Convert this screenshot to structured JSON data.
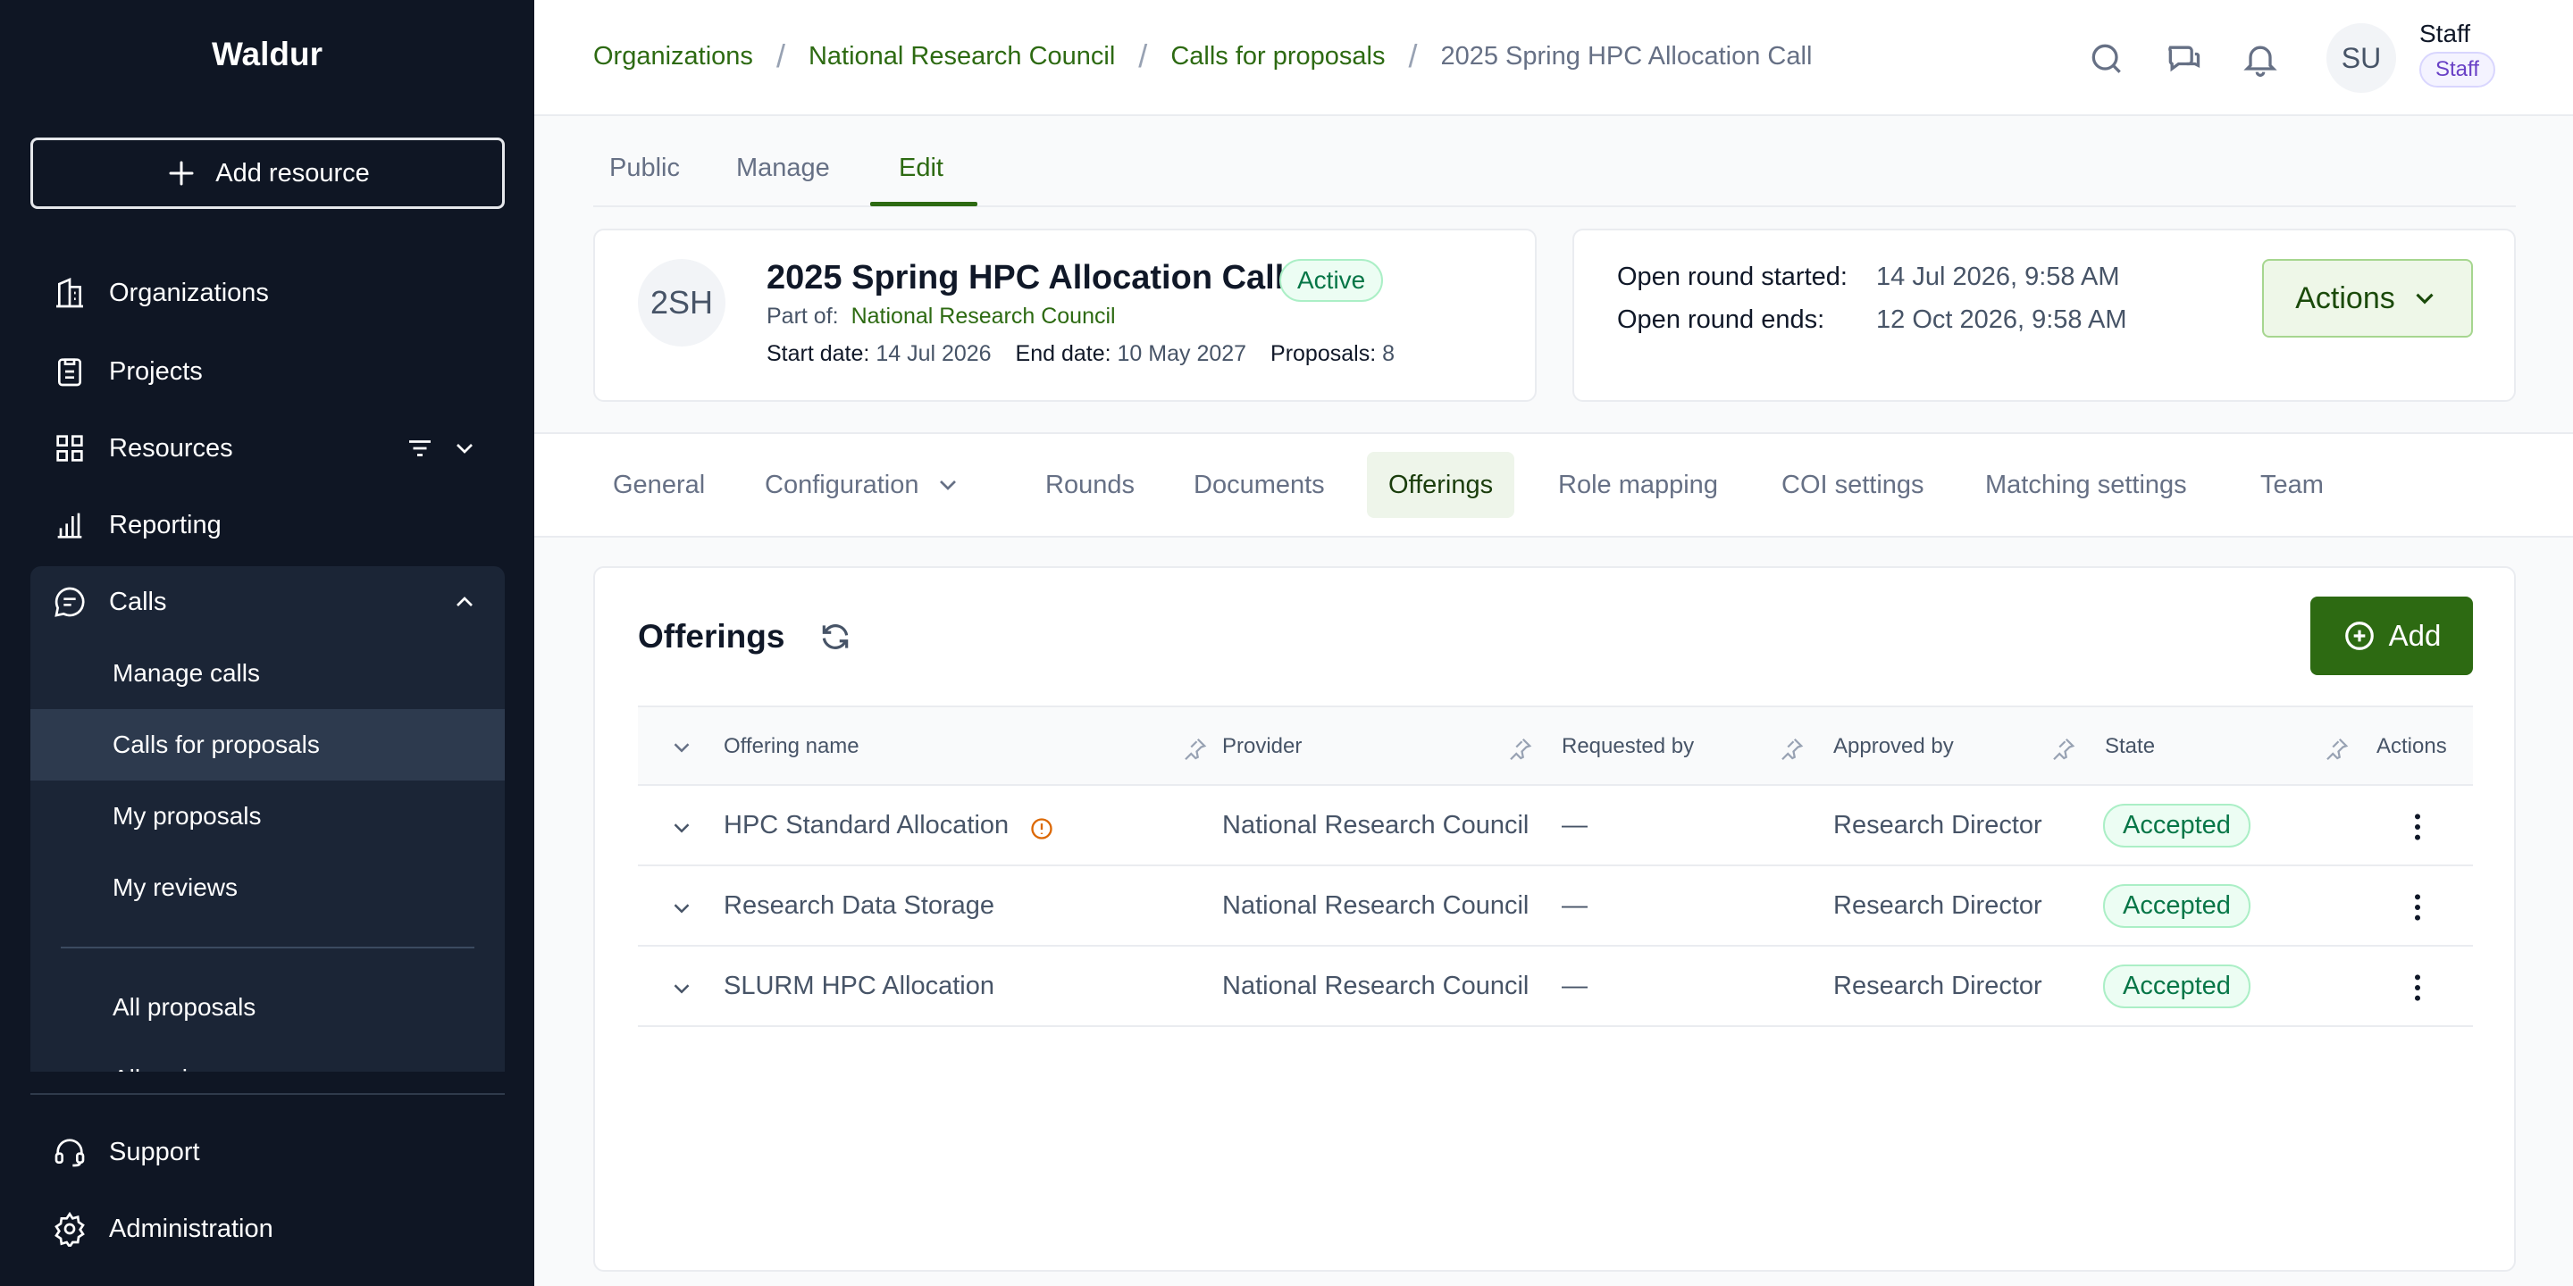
{
  "sidebar": {
    "brand": "Waldur",
    "add_resource": "Add resource",
    "items": [
      {
        "label": "Organizations",
        "icon": "building-icon"
      },
      {
        "label": "Projects",
        "icon": "clipboard-icon"
      },
      {
        "label": "Resources",
        "icon": "grid-icon"
      },
      {
        "label": "Reporting",
        "icon": "bar-chart-icon"
      }
    ],
    "calls": {
      "label": "Calls",
      "sub": [
        "Manage calls",
        "Calls for proposals",
        "My proposals",
        "My reviews",
        "All proposals",
        "All reviews"
      ]
    },
    "bottom": [
      {
        "label": "Support",
        "icon": "headset-icon"
      },
      {
        "label": "Administration",
        "icon": "gear-icon"
      }
    ]
  },
  "header": {
    "breadcrumbs": [
      "Organizations",
      "National Research Council",
      "Calls for proposals"
    ],
    "current": "2025 Spring HPC Allocation Call",
    "user_initials": "SU",
    "user_name": "Staff",
    "user_role": "Staff"
  },
  "page_tabs": [
    "Public",
    "Manage",
    "Edit"
  ],
  "call": {
    "badge": "2SH",
    "title": "2025 Spring HPC Allocation Call",
    "status": "Active",
    "part_of_label": "Part of:",
    "part_of": "National Research Council",
    "start_label": "Start date:",
    "start": "14 Jul 2026",
    "end_label": "End date:",
    "end": "10 May 2027",
    "proposals_label": "Proposals:",
    "proposals": "8"
  },
  "round": {
    "started_label": "Open round started:",
    "started": "14 Jul 2026, 9:58 AM",
    "ends_label": "Open round ends:",
    "ends": "12 Oct 2026, 9:58 AM",
    "actions": "Actions"
  },
  "section_tabs": [
    "General",
    "Configuration",
    "Rounds",
    "Documents",
    "Offerings",
    "Role mapping",
    "COI settings",
    "Matching settings",
    "Team"
  ],
  "offerings": {
    "title": "Offerings",
    "add": "Add",
    "columns": [
      "Offering name",
      "Provider",
      "Requested by",
      "Approved by",
      "State",
      "Actions"
    ],
    "rows": [
      {
        "name": "HPC Standard Allocation",
        "provider": "National Research Council",
        "requested_by": "—",
        "approved_by": "Research Director",
        "state": "Accepted"
      },
      {
        "name": "Research Data Storage",
        "provider": "National Research Council",
        "requested_by": "—",
        "approved_by": "Research Director",
        "state": "Accepted"
      },
      {
        "name": "SLURM HPC Allocation",
        "provider": "National Research Council",
        "requested_by": "—",
        "approved_by": "Research Director",
        "state": "Accepted"
      }
    ]
  },
  "colors": {
    "accent": "#2d6a12",
    "sidebar_bg": "#0f1624",
    "success": "#067647"
  }
}
